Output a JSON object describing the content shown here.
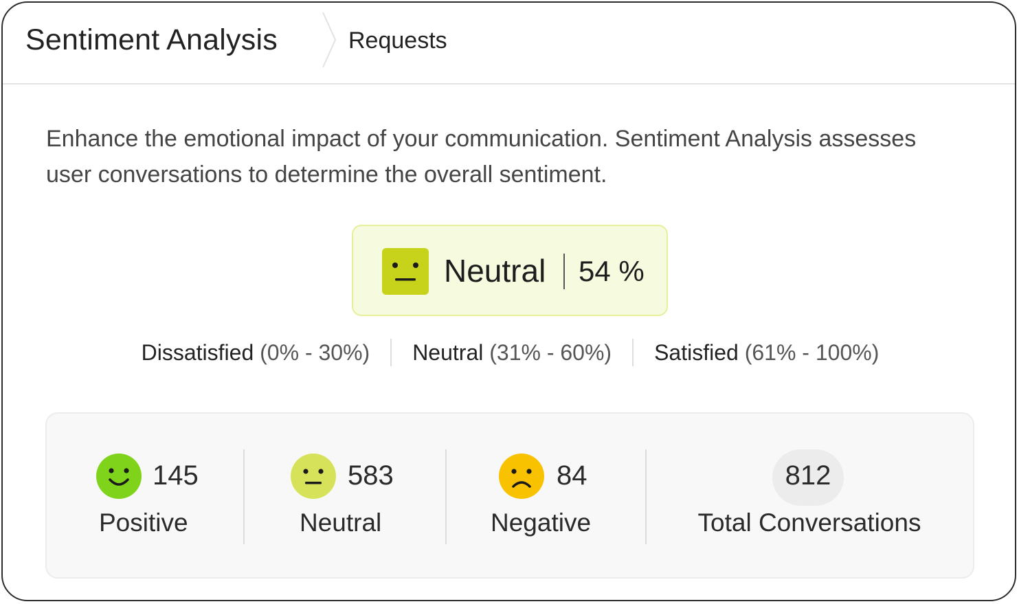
{
  "header": {
    "title": "Sentiment Analysis",
    "breadcrumb": "Requests"
  },
  "description": "Enhance the emotional impact of your communication. Sentiment Analysis assesses user conversations to determine the overall sentiment.",
  "overall": {
    "label": "Neutral",
    "value_text": "54 %",
    "percent": 54,
    "icon": "neutral-face-icon",
    "color": "#c7d21b"
  },
  "ranges": [
    {
      "name": "Dissatisfied",
      "range": "(0% - 30%)"
    },
    {
      "name": "Neutral",
      "range": "(31% - 60%)"
    },
    {
      "name": "Satisfied",
      "range": "(61% - 100%)"
    }
  ],
  "stats": {
    "positive": {
      "count": "145",
      "label": "Positive",
      "icon": "smiley-face-icon",
      "color": "#7fd31a"
    },
    "neutral": {
      "count": "583",
      "label": "Neutral",
      "icon": "neutral-face-icon",
      "color": "#d6e35a"
    },
    "negative": {
      "count": "84",
      "label": "Negative",
      "icon": "sad-face-icon",
      "color": "#f9c200"
    },
    "total": {
      "count": "812",
      "label": "Total Conversations"
    }
  }
}
